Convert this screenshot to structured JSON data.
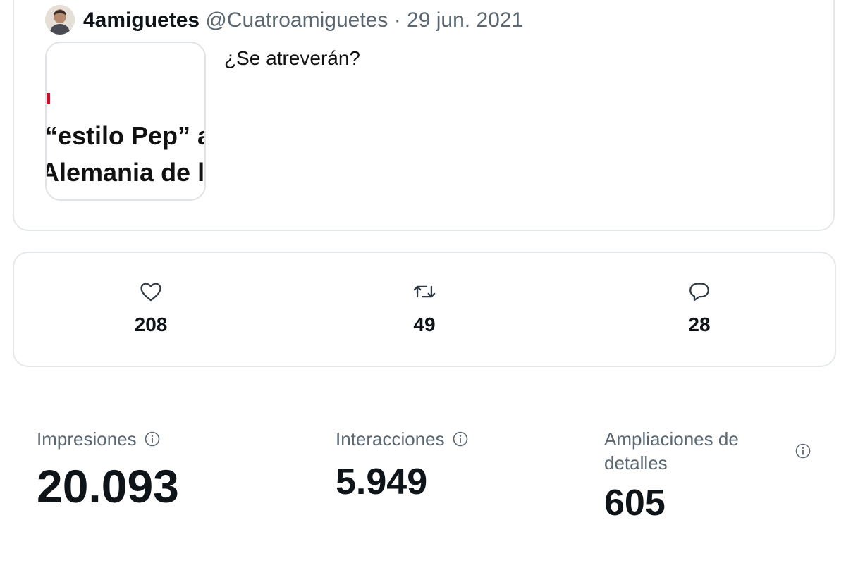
{
  "tweet": {
    "display_name": "4amiguetes",
    "handle": "@Cuatroamiguetes",
    "separator": "·",
    "date": "29 jun. 2021",
    "text": "¿Se atreverán?",
    "media_preview": {
      "line1": "“estilo Pep” a",
      "line2": "Alemania de l"
    }
  },
  "engagement": {
    "likes": {
      "icon": "heart-icon",
      "count": "208"
    },
    "retweets": {
      "icon": "retweet-icon",
      "count": "49"
    },
    "replies": {
      "icon": "reply-icon",
      "count": "28"
    }
  },
  "analytics": {
    "impressions": {
      "label": "Impresiones",
      "value": "20.093",
      "icon": "info-icon"
    },
    "interactions": {
      "label": "Interacciones",
      "value": "5.949",
      "icon": "info-icon"
    },
    "detail_expansions": {
      "label": "Ampliaciones de detalles",
      "value": "605",
      "icon": "info-icon"
    }
  },
  "colors": {
    "text_primary": "#0f1419",
    "text_secondary": "#5b6771",
    "border": "#e4e8eb",
    "accent_red": "#c8102e"
  }
}
